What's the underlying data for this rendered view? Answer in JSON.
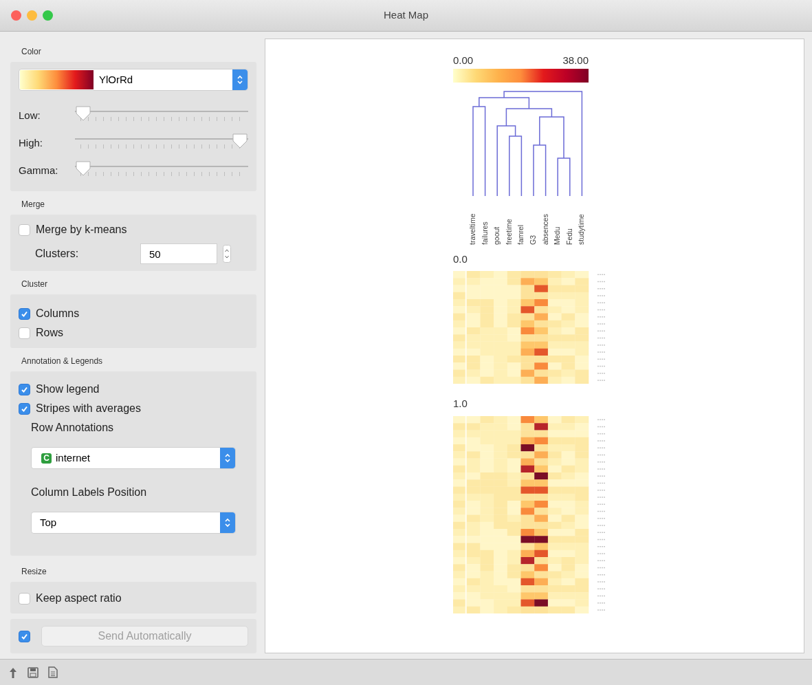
{
  "window": {
    "title": "Heat Map"
  },
  "color_box": {
    "title": "Color",
    "palette": "YlOrRd",
    "sliders": [
      {
        "label": "Low:",
        "level": 0.0
      },
      {
        "label": "High:",
        "level": 1.0
      },
      {
        "label": "Gamma:",
        "level": 0.0
      }
    ]
  },
  "merge_box": {
    "title": "Merge",
    "merge_option": {
      "label": "Merge by k-means",
      "checked": false
    },
    "clusters": {
      "label": "Clusters:",
      "value": "50"
    }
  },
  "cluster_box": {
    "title": "Cluster",
    "options": [
      {
        "label": "Columns",
        "checked": true
      },
      {
        "label": "Rows",
        "checked": false
      }
    ]
  },
  "annotation_box": {
    "title": "Annotation & Legends",
    "options": [
      {
        "label": "Show legend",
        "checked": true
      },
      {
        "label": "Stripes with averages",
        "checked": true
      }
    ],
    "row_annotations": {
      "label": "Row Annotations",
      "badge": "C",
      "value": "internet"
    },
    "column_labels_position": {
      "label": "Column Labels Position",
      "value": "Top"
    }
  },
  "resize_box": {
    "title": "Resize",
    "options": [
      {
        "label": "Keep aspect ratio",
        "checked": false
      }
    ]
  },
  "send": {
    "checked": true,
    "button": "Send Automatically",
    "disabled": true
  },
  "heatmap": {
    "legend": {
      "min": "0.00",
      "max": "38.00"
    },
    "column_labels": [
      "traveltime",
      "failures",
      "goout",
      "freetime",
      "famrel",
      "G3",
      "absences",
      "Medu",
      "Fedu",
      "studytime"
    ],
    "groups": [
      {
        "label": "0.0"
      },
      {
        "label": "1.0"
      }
    ]
  }
}
